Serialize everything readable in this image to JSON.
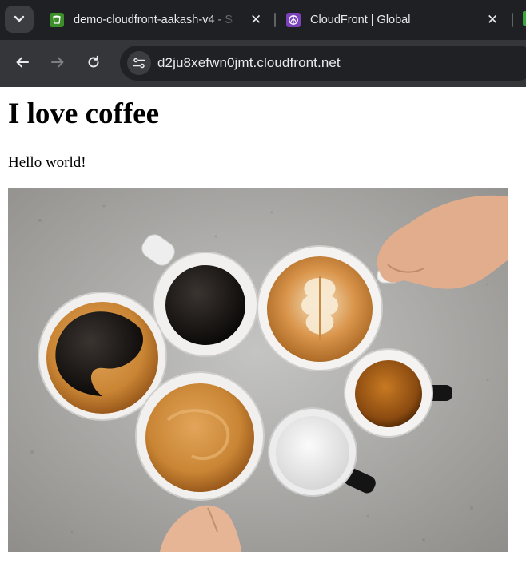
{
  "browser": {
    "tabs": [
      {
        "title": "demo-cloudfront-aakash-v4 - S",
        "favicon": "s3-bucket-icon",
        "favicon_color": "#3b8e2a"
      },
      {
        "title": "CloudFront | Global",
        "favicon": "cloudfront-icon",
        "favicon_color": "#7b42bc"
      }
    ],
    "address_bar": {
      "url": "d2ju8xefwn0jmt.cloudfront.net"
    }
  },
  "page": {
    "heading": "I love coffee",
    "paragraph": "Hello world!",
    "image": {
      "subject": "coffee-cups-photo"
    }
  }
}
